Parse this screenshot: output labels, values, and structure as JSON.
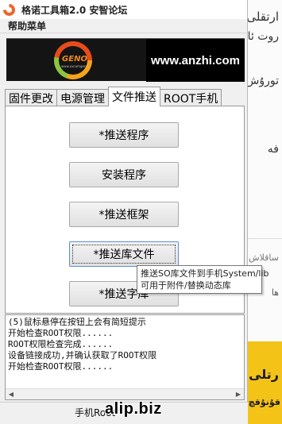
{
  "window": {
    "title": "格诺工具箱2.0 安智论坛"
  },
  "menu": {
    "help_label": "帮助菜单"
  },
  "banner": {
    "logo_text": "GENO",
    "logo_subtext": "www.xxcomgeno",
    "site_text": "www.anzhi.com"
  },
  "tabs": [
    {
      "label": "固件更改",
      "active": false
    },
    {
      "label": "电源管理",
      "active": false
    },
    {
      "label": "文件推送",
      "active": true
    },
    {
      "label": "ROOT手机",
      "active": false
    }
  ],
  "actions": [
    {
      "label": "*推送程序"
    },
    {
      "label": "安装程序"
    },
    {
      "label": "*推送框架"
    },
    {
      "label": "*推送库文件",
      "hovered": true
    },
    {
      "label": "*推送字库"
    }
  ],
  "tooltip": {
    "line1": "推送SO库文件到手机System/lib",
    "line2": "可用于附件/替换动态库"
  },
  "log": {
    "lines": [
      "(5)鼠标悬停在按钮上会有简短提示",
      "开始检查ROOT权限......",
      "ROOT权限检查完成......",
      "设备链接成功,并确认获取了ROOT权限",
      "开始检查ROOT权限......"
    ]
  },
  "status": {
    "text": "手机Root"
  },
  "watermark": "alip.biz",
  "background_page": {
    "line1": "ارتقلى",
    "line2": "روت ئا",
    "line3": "تورۇش",
    "line4": "فه",
    "line5": "ساقلاش",
    "line6": "ها",
    "banner_line1": "رتلى",
    "banner_line2": "قۇنۇقچ"
  },
  "colors": {
    "accent_orange": "#f08a1b",
    "banner_yellow": "#f4c318",
    "window_bg": "#f0f0f0"
  }
}
